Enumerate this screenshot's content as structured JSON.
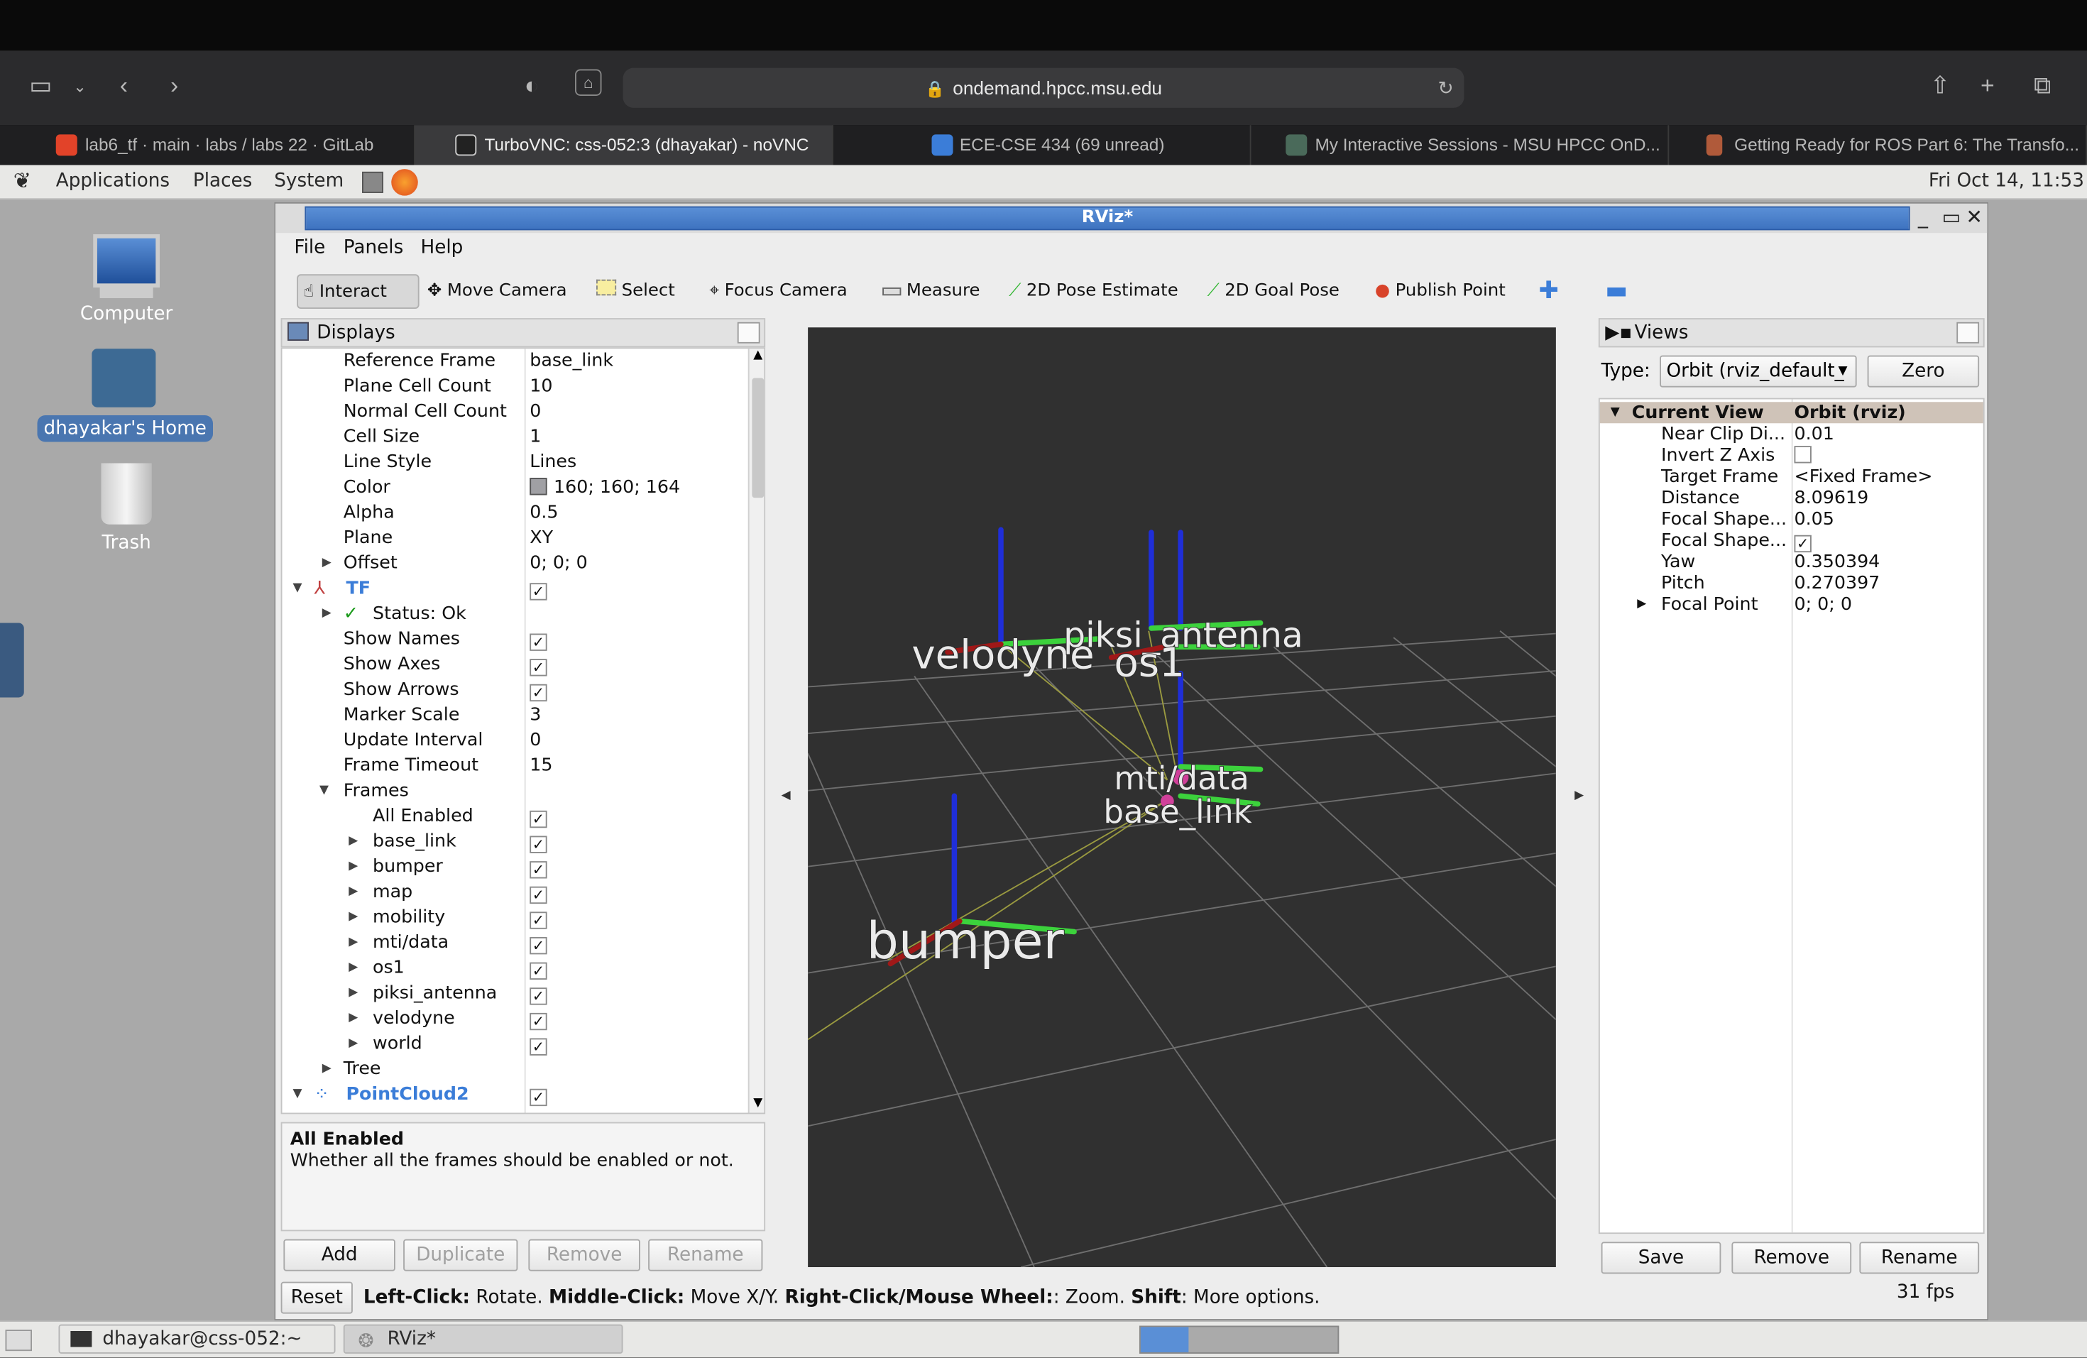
{
  "browser": {
    "url": "ondemand.hpcc.msu.edu",
    "tabs": [
      {
        "label": "lab6_tf · main · labs / labs 22 · GitLab"
      },
      {
        "label": "TurboVNC: css-052:3 (dhayakar) - noVNC"
      },
      {
        "label": "ECE-CSE 434 (69 unread)"
      },
      {
        "label": "My Interactive Sessions - MSU HPCC OnD..."
      },
      {
        "label": "Getting Ready for ROS Part 6: The Transfo..."
      }
    ]
  },
  "gnome": {
    "menus": [
      "Applications",
      "Places",
      "System"
    ],
    "clock": "Fri Oct 14, 11:53",
    "desktop_icons": [
      "Computer",
      "dhayakar's Home",
      "Trash"
    ],
    "taskbar": [
      "dhayakar@css-052:~",
      "RViz*"
    ]
  },
  "rviz": {
    "title": "RViz*",
    "menu": [
      "File",
      "Panels",
      "Help"
    ],
    "tools": [
      "Interact",
      "Move Camera",
      "Select",
      "Focus Camera",
      "Measure",
      "2D Pose Estimate",
      "2D Goal Pose",
      "Publish Point"
    ],
    "displays": {
      "title": "Displays",
      "rows": [
        {
          "k": "Reference Frame",
          "v": "base_link"
        },
        {
          "k": "Plane Cell Count",
          "v": "10"
        },
        {
          "k": "Normal Cell Count",
          "v": "0"
        },
        {
          "k": "Cell Size",
          "v": "1"
        },
        {
          "k": "Line Style",
          "v": "Lines"
        },
        {
          "k": "Color",
          "v": "160; 160; 164"
        },
        {
          "k": "Alpha",
          "v": "0.5"
        },
        {
          "k": "Plane",
          "v": "XY"
        },
        {
          "k": "Offset",
          "v": "0; 0; 0"
        },
        {
          "k": "TF",
          "v": ""
        },
        {
          "k": "Status: Ok",
          "v": ""
        },
        {
          "k": "Show Names",
          "v": ""
        },
        {
          "k": "Show Axes",
          "v": ""
        },
        {
          "k": "Show Arrows",
          "v": ""
        },
        {
          "k": "Marker Scale",
          "v": "3"
        },
        {
          "k": "Update Interval",
          "v": "0"
        },
        {
          "k": "Frame Timeout",
          "v": "15"
        },
        {
          "k": "Frames",
          "v": ""
        },
        {
          "k": "All Enabled",
          "v": ""
        },
        {
          "k": "base_link",
          "v": ""
        },
        {
          "k": "bumper",
          "v": ""
        },
        {
          "k": "map",
          "v": ""
        },
        {
          "k": "mobility",
          "v": ""
        },
        {
          "k": "mti/data",
          "v": ""
        },
        {
          "k": "os1",
          "v": ""
        },
        {
          "k": "piksi_antenna",
          "v": ""
        },
        {
          "k": "velodyne",
          "v": ""
        },
        {
          "k": "world",
          "v": ""
        },
        {
          "k": "Tree",
          "v": ""
        },
        {
          "k": "PointCloud2",
          "v": ""
        }
      ],
      "description_title": "All Enabled",
      "description_text": "Whether all the frames should be enabled or not.",
      "buttons": [
        "Add",
        "Duplicate",
        "Remove",
        "Rename"
      ]
    },
    "viewport_labels": [
      "velodyne",
      "piksi_antenna",
      "os1",
      "mti/data",
      "base_link",
      "bumper"
    ],
    "views": {
      "title": "Views",
      "type_label": "Type:",
      "type_value": "Orbit (rviz_default_",
      "zero_label": "Zero",
      "header_k": "Current View",
      "header_v": "Orbit (rviz)",
      "rows": [
        {
          "k": "Near Clip Di...",
          "v": "0.01"
        },
        {
          "k": "Invert Z Axis",
          "v": ""
        },
        {
          "k": "Target Frame",
          "v": "<Fixed Frame>"
        },
        {
          "k": "Distance",
          "v": "8.09619"
        },
        {
          "k": "Focal Shape...",
          "v": "0.05"
        },
        {
          "k": "Focal Shape...",
          "v": ""
        },
        {
          "k": "Yaw",
          "v": "0.350394"
        },
        {
          "k": "Pitch",
          "v": "0.270397"
        },
        {
          "k": "Focal Point",
          "v": "0; 0; 0"
        }
      ],
      "buttons": [
        "Save",
        "Remove",
        "Rename"
      ]
    },
    "status": {
      "reset": "Reset",
      "b1": "Left-Click:",
      "t1": " Rotate. ",
      "b2": "Middle-Click:",
      "t2": " Move X/Y. ",
      "b3": "Right-Click/Mouse Wheel:",
      "t3": ": Zoom. ",
      "b4": "Shift",
      "t4": ": More options.",
      "fps": "31 fps"
    },
    "colors": {
      "accent": "#3e73c0",
      "selected_header": "#cfc3b8",
      "viewport_bg": "#303030"
    }
  }
}
